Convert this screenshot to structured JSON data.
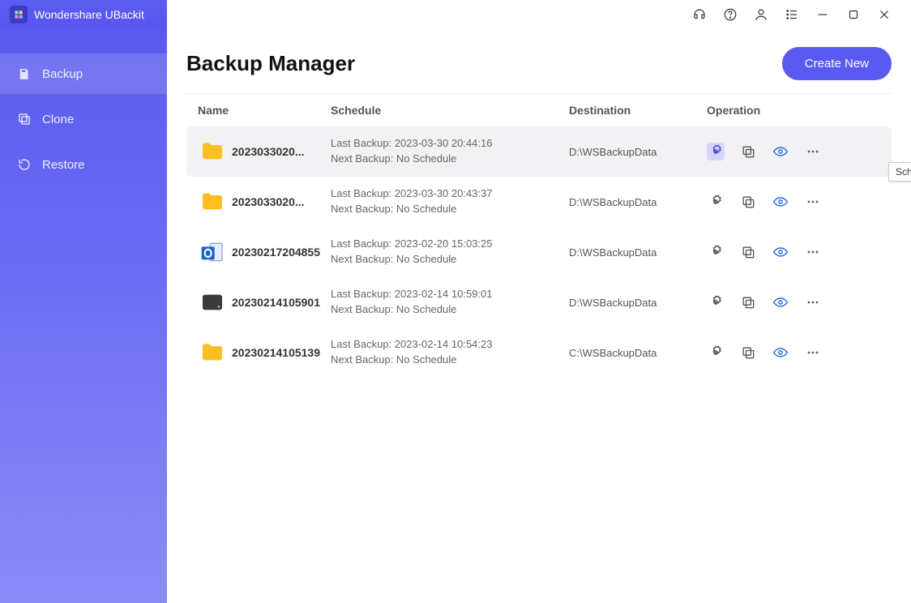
{
  "app": {
    "title": "Wondershare UBackit"
  },
  "sidebar": {
    "items": [
      {
        "label": "Backup",
        "active": true
      },
      {
        "label": "Clone",
        "active": false
      },
      {
        "label": "Restore",
        "active": false
      }
    ]
  },
  "page": {
    "title": "Backup Manager",
    "create_label": "Create New"
  },
  "columns": {
    "name": "Name",
    "schedule": "Schedule",
    "destination": "Destination",
    "operation": "Operation"
  },
  "schedule_labels": {
    "last_prefix": "Last Backup: ",
    "next_prefix": "Next Backup: "
  },
  "rows": [
    {
      "icon": "folder",
      "name": "2023033020...",
      "last": "2023-03-30 20:44:16",
      "next": "No Schedule",
      "dest": "D:\\WSBackupData",
      "hovered": true
    },
    {
      "icon": "folder",
      "name": "2023033020...",
      "last": "2023-03-30 20:43:37",
      "next": "No Schedule",
      "dest": "D:\\WSBackupData",
      "hovered": false
    },
    {
      "icon": "outlook",
      "name": "20230217204855",
      "last": "2023-02-20 15:03:25",
      "next": "No Schedule",
      "dest": "D:\\WSBackupData",
      "hovered": false
    },
    {
      "icon": "disk",
      "name": "20230214105901",
      "last": "2023-02-14 10:59:01",
      "next": "No Schedule",
      "dest": "D:\\WSBackupData",
      "hovered": false
    },
    {
      "icon": "folder",
      "name": "20230214105139",
      "last": "2023-02-14 10:54:23",
      "next": "No Schedule",
      "dest": "C:\\WSBackupData",
      "hovered": false
    }
  ],
  "tooltip": "Schedule"
}
